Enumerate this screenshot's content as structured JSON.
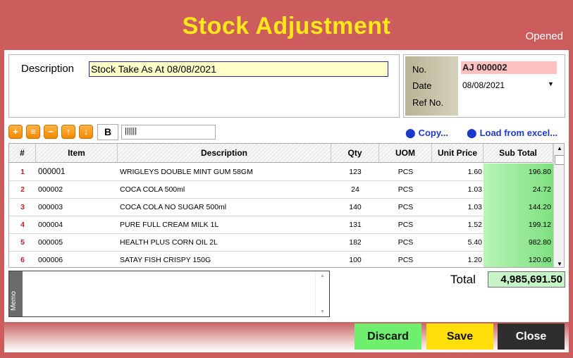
{
  "window": {
    "title": "Stock Adjustment",
    "status": "Opened"
  },
  "header": {
    "description_label": "Description",
    "description_value": "Stock Take As At 08/08/2021",
    "no_label": "No.",
    "no_value": "AJ 000002",
    "date_label": "Date",
    "date_value": "08/08/2021",
    "ref_label": "Ref No."
  },
  "toolbar": {
    "add_icon": "plus-icon",
    "insert_icon": "insert-row-icon",
    "remove_icon": "minus-icon",
    "up_icon": "arrow-up-icon",
    "down_icon": "arrow-down-icon",
    "bold_label": "B",
    "barcode_glyph": "||||||",
    "copy_link": "Copy...",
    "load_link": "Load from excel..."
  },
  "grid": {
    "columns": [
      "#",
      "Item",
      "Description",
      "Qty",
      "UOM",
      "Unit Price",
      "Sub Total"
    ],
    "rows": [
      {
        "n": "1",
        "item": "000001",
        "desc": "WRIGLEYS DOUBLE MINT GUM 58GM",
        "qty": "123",
        "uom": "PCS",
        "price": "1.60",
        "sub": "196.80"
      },
      {
        "n": "2",
        "item": "000002",
        "desc": "COCA COLA 500ml",
        "qty": "24",
        "uom": "PCS",
        "price": "1.03",
        "sub": "24.72"
      },
      {
        "n": "3",
        "item": "000003",
        "desc": "COCA COLA NO SUGAR 500ml",
        "qty": "140",
        "uom": "PCS",
        "price": "1.03",
        "sub": "144.20"
      },
      {
        "n": "4",
        "item": "000004",
        "desc": "PURE FULL CREAM MILK 1L",
        "qty": "131",
        "uom": "PCS",
        "price": "1.52",
        "sub": "199.12"
      },
      {
        "n": "5",
        "item": "000005",
        "desc": "HEALTH PLUS CORN OIL 2L",
        "qty": "182",
        "uom": "PCS",
        "price": "5.40",
        "sub": "982.80"
      },
      {
        "n": "6",
        "item": "000006",
        "desc": "SATAY FISH CRISPY 150G",
        "qty": "100",
        "uom": "PCS",
        "price": "1.20",
        "sub": "120.00"
      }
    ]
  },
  "memo": {
    "label": "Memo",
    "text": ""
  },
  "totals": {
    "label": "Total",
    "value": "4,985,691.50"
  },
  "actions": {
    "discard": "Discard",
    "save": "Save",
    "close": "Close"
  },
  "colors": {
    "window_bg": "#cd5c5c",
    "title": "#ffe81a",
    "discard": "#6ef06e",
    "save": "#ffde0a",
    "close": "#2e2e2e",
    "link": "#1c3ac8"
  }
}
